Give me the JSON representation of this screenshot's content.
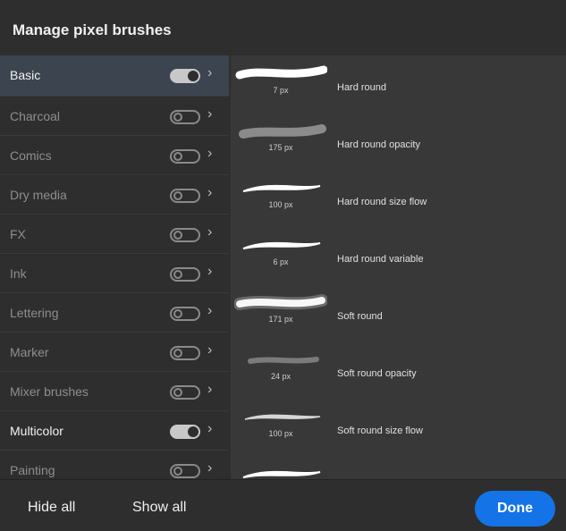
{
  "dialog": {
    "title": "Manage pixel brushes"
  },
  "categories": [
    {
      "label": "Basic",
      "enabled": true,
      "selected": true
    },
    {
      "label": "Charcoal",
      "enabled": false,
      "selected": false
    },
    {
      "label": "Comics",
      "enabled": false,
      "selected": false
    },
    {
      "label": "Dry media",
      "enabled": false,
      "selected": false
    },
    {
      "label": "FX",
      "enabled": false,
      "selected": false
    },
    {
      "label": "Ink",
      "enabled": false,
      "selected": false
    },
    {
      "label": "Lettering",
      "enabled": false,
      "selected": false
    },
    {
      "label": "Marker",
      "enabled": false,
      "selected": false
    },
    {
      "label": "Mixer brushes",
      "enabled": false,
      "selected": false
    },
    {
      "label": "Multicolor",
      "enabled": true,
      "selected": false
    },
    {
      "label": "Painting",
      "enabled": false,
      "selected": false
    }
  ],
  "brushes": [
    {
      "size": "7 px",
      "name": "Hard round",
      "style": "hard"
    },
    {
      "size": "175 px",
      "name": "Hard round opacity",
      "style": "soft-gray"
    },
    {
      "size": "100 px",
      "name": "Hard round size flow",
      "style": "taper"
    },
    {
      "size": "6 px",
      "name": "Hard round variable",
      "style": "taper"
    },
    {
      "size": "171 px",
      "name": "Soft round",
      "style": "glow"
    },
    {
      "size": "24 px",
      "name": "Soft round opacity",
      "style": "faint"
    },
    {
      "size": "100 px",
      "name": "Soft round size flow",
      "style": "taper-soft"
    },
    {
      "size": "",
      "name": "",
      "style": "taper"
    }
  ],
  "footer": {
    "hide_all": "Hide all",
    "show_all": "Show all",
    "done": "Done"
  },
  "colors": {
    "accent": "#1473e6",
    "selected_row": "#3c4450"
  }
}
